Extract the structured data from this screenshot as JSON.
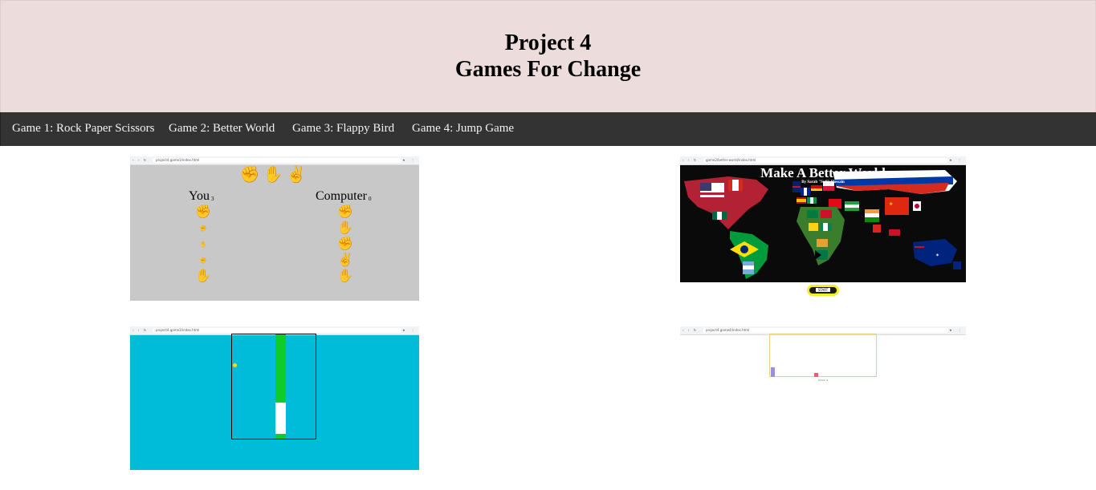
{
  "header": {
    "title_line1": "Project 4",
    "title_line2": "Games For Change"
  },
  "nav": {
    "items": [
      {
        "label": "Game 1: Rock Paper Scissors"
      },
      {
        "label": "Game 2: Better World"
      },
      {
        "label": "Game 3: Flappy Bird"
      },
      {
        "label": "Game 4: Jump Game"
      }
    ]
  },
  "game1": {
    "url": "project4.game1/index.html",
    "hands": "✊✋✌",
    "you_label": "You",
    "you_score": "3",
    "computer_label": "Computer",
    "computer_score": "0",
    "you_col": [
      "✊",
      "✊",
      "✋",
      "✊",
      "✋"
    ],
    "computer_col": [
      "✊",
      "✋",
      "✊",
      "✌",
      "✋"
    ]
  },
  "game2": {
    "url": "game2/better-world/index.html",
    "title": "Make A Better World",
    "byline": "By Sarah \"Sufi\" Hossain",
    "start_label": "START"
  },
  "game3": {
    "url": "project4.game3/index.html"
  },
  "game4": {
    "url": "project4.game4/index.html",
    "score": "Score: 4"
  },
  "colors": {
    "header_bg": "#ecdcdc",
    "nav_bg": "#333333",
    "flappy_sky": "#00bcd8",
    "pipe": "#0fcc2a"
  }
}
